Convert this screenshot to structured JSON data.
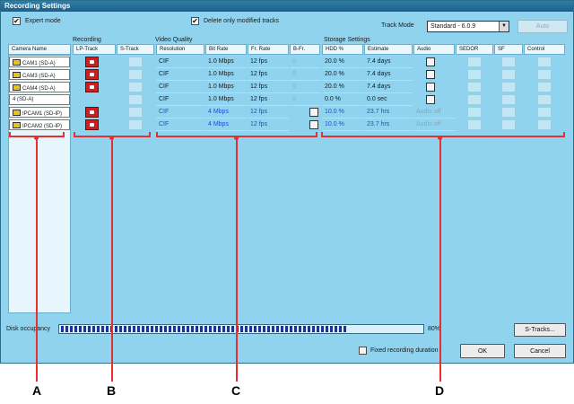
{
  "window": {
    "title": "Recording Settings"
  },
  "topbar": {
    "expert_mode": {
      "label": "Expert mode",
      "checked": true
    },
    "delete_modified": {
      "label": "Delete only modified tracks",
      "checked": true
    },
    "track_mode_label": "Track Mode",
    "track_mode_value": "Standard - 6.0.9",
    "auto_label": "Auto"
  },
  "groups": {
    "recording": "Recording",
    "video_quality": "Video Quality",
    "storage_settings": "Storage Settings"
  },
  "columns": {
    "camera_name": "Camera Name",
    "lp_track": "LP-Track",
    "s_track": "S-Track",
    "resolution": "Resolution",
    "bit_rate": "Bit Rate",
    "fr_rate": "Fr. Rate",
    "b_fr": "B-Fr.",
    "hdd": "HDD %",
    "estimate": "Estimate",
    "audio": "Audio",
    "sedor": "SEDOR",
    "sf": "SF",
    "control": "Control"
  },
  "rows": [
    {
      "camera": "CAM1 (SD-A)",
      "icon": true,
      "lp": true,
      "resolution": "CIF",
      "bit_rate": "1.0 Mbps",
      "fr_rate": "12 fps",
      "b_fr": "0",
      "hdd": "20.0 %",
      "estimate": "7.4 days",
      "audio": "",
      "style": "normal"
    },
    {
      "camera": "CAM3 (SD-A)",
      "icon": true,
      "lp": true,
      "resolution": "CIF",
      "bit_rate": "1.0 Mbps",
      "fr_rate": "12 fps",
      "b_fr": "0",
      "hdd": "20.0 %",
      "estimate": "7.4 days",
      "audio": "",
      "style": "normal"
    },
    {
      "camera": "CAM4 (SD-A)",
      "icon": true,
      "lp": true,
      "resolution": "CIF",
      "bit_rate": "1.0 Mbps",
      "fr_rate": "12 fps",
      "b_fr": "0",
      "hdd": "20.0 %",
      "estimate": "7.4 days",
      "audio": "",
      "style": "normal"
    },
    {
      "camera": "4 (SD-A)",
      "icon": false,
      "lp": false,
      "resolution": "CIF",
      "bit_rate": "1.0 Mbps",
      "fr_rate": "12 fps",
      "b_fr": "0",
      "hdd": "0.0 %",
      "estimate": "0.0 sec",
      "audio": "",
      "style": "normal"
    },
    {
      "camera": "IPCAM1 (SD-IP)",
      "icon": true,
      "lp": true,
      "resolution": "CIF",
      "bit_rate": "4 Mbps",
      "fr_rate": "12 fps",
      "b_fr": "",
      "hdd": "10.0 %",
      "estimate": "23.7 hrs",
      "audio": "Audio off",
      "style": "blue"
    },
    {
      "camera": "IPCAM2 (SD-IP)",
      "icon": true,
      "lp": true,
      "resolution": "CIF",
      "bit_rate": "4 Mbps",
      "fr_rate": "12 fps",
      "b_fr": "",
      "hdd": "10.0 %",
      "estimate": "23.7 hrs",
      "audio": "Audio off",
      "style": "blue"
    }
  ],
  "footer": {
    "disk_occupancy_label": "Disk occupancy",
    "disk_occupancy_value": "80",
    "disk_occupancy_text": "80%",
    "s_tracks_label": "S-Tracks...",
    "fixed_duration_label": "Fixed recording duration",
    "fixed_duration_checked": false,
    "ok_label": "OK",
    "cancel_label": "Cancel"
  },
  "callouts": {
    "a": "A",
    "b": "B",
    "c": "C",
    "d": "D",
    "color": "#e53030"
  },
  "colors": {
    "window_bg": "#8fd3ee",
    "titlebar": "#2f7fa8",
    "lp_button": "#cc1f1f",
    "progress_fill": "#1c2fa5",
    "ip_text": "#1e4fd0"
  }
}
